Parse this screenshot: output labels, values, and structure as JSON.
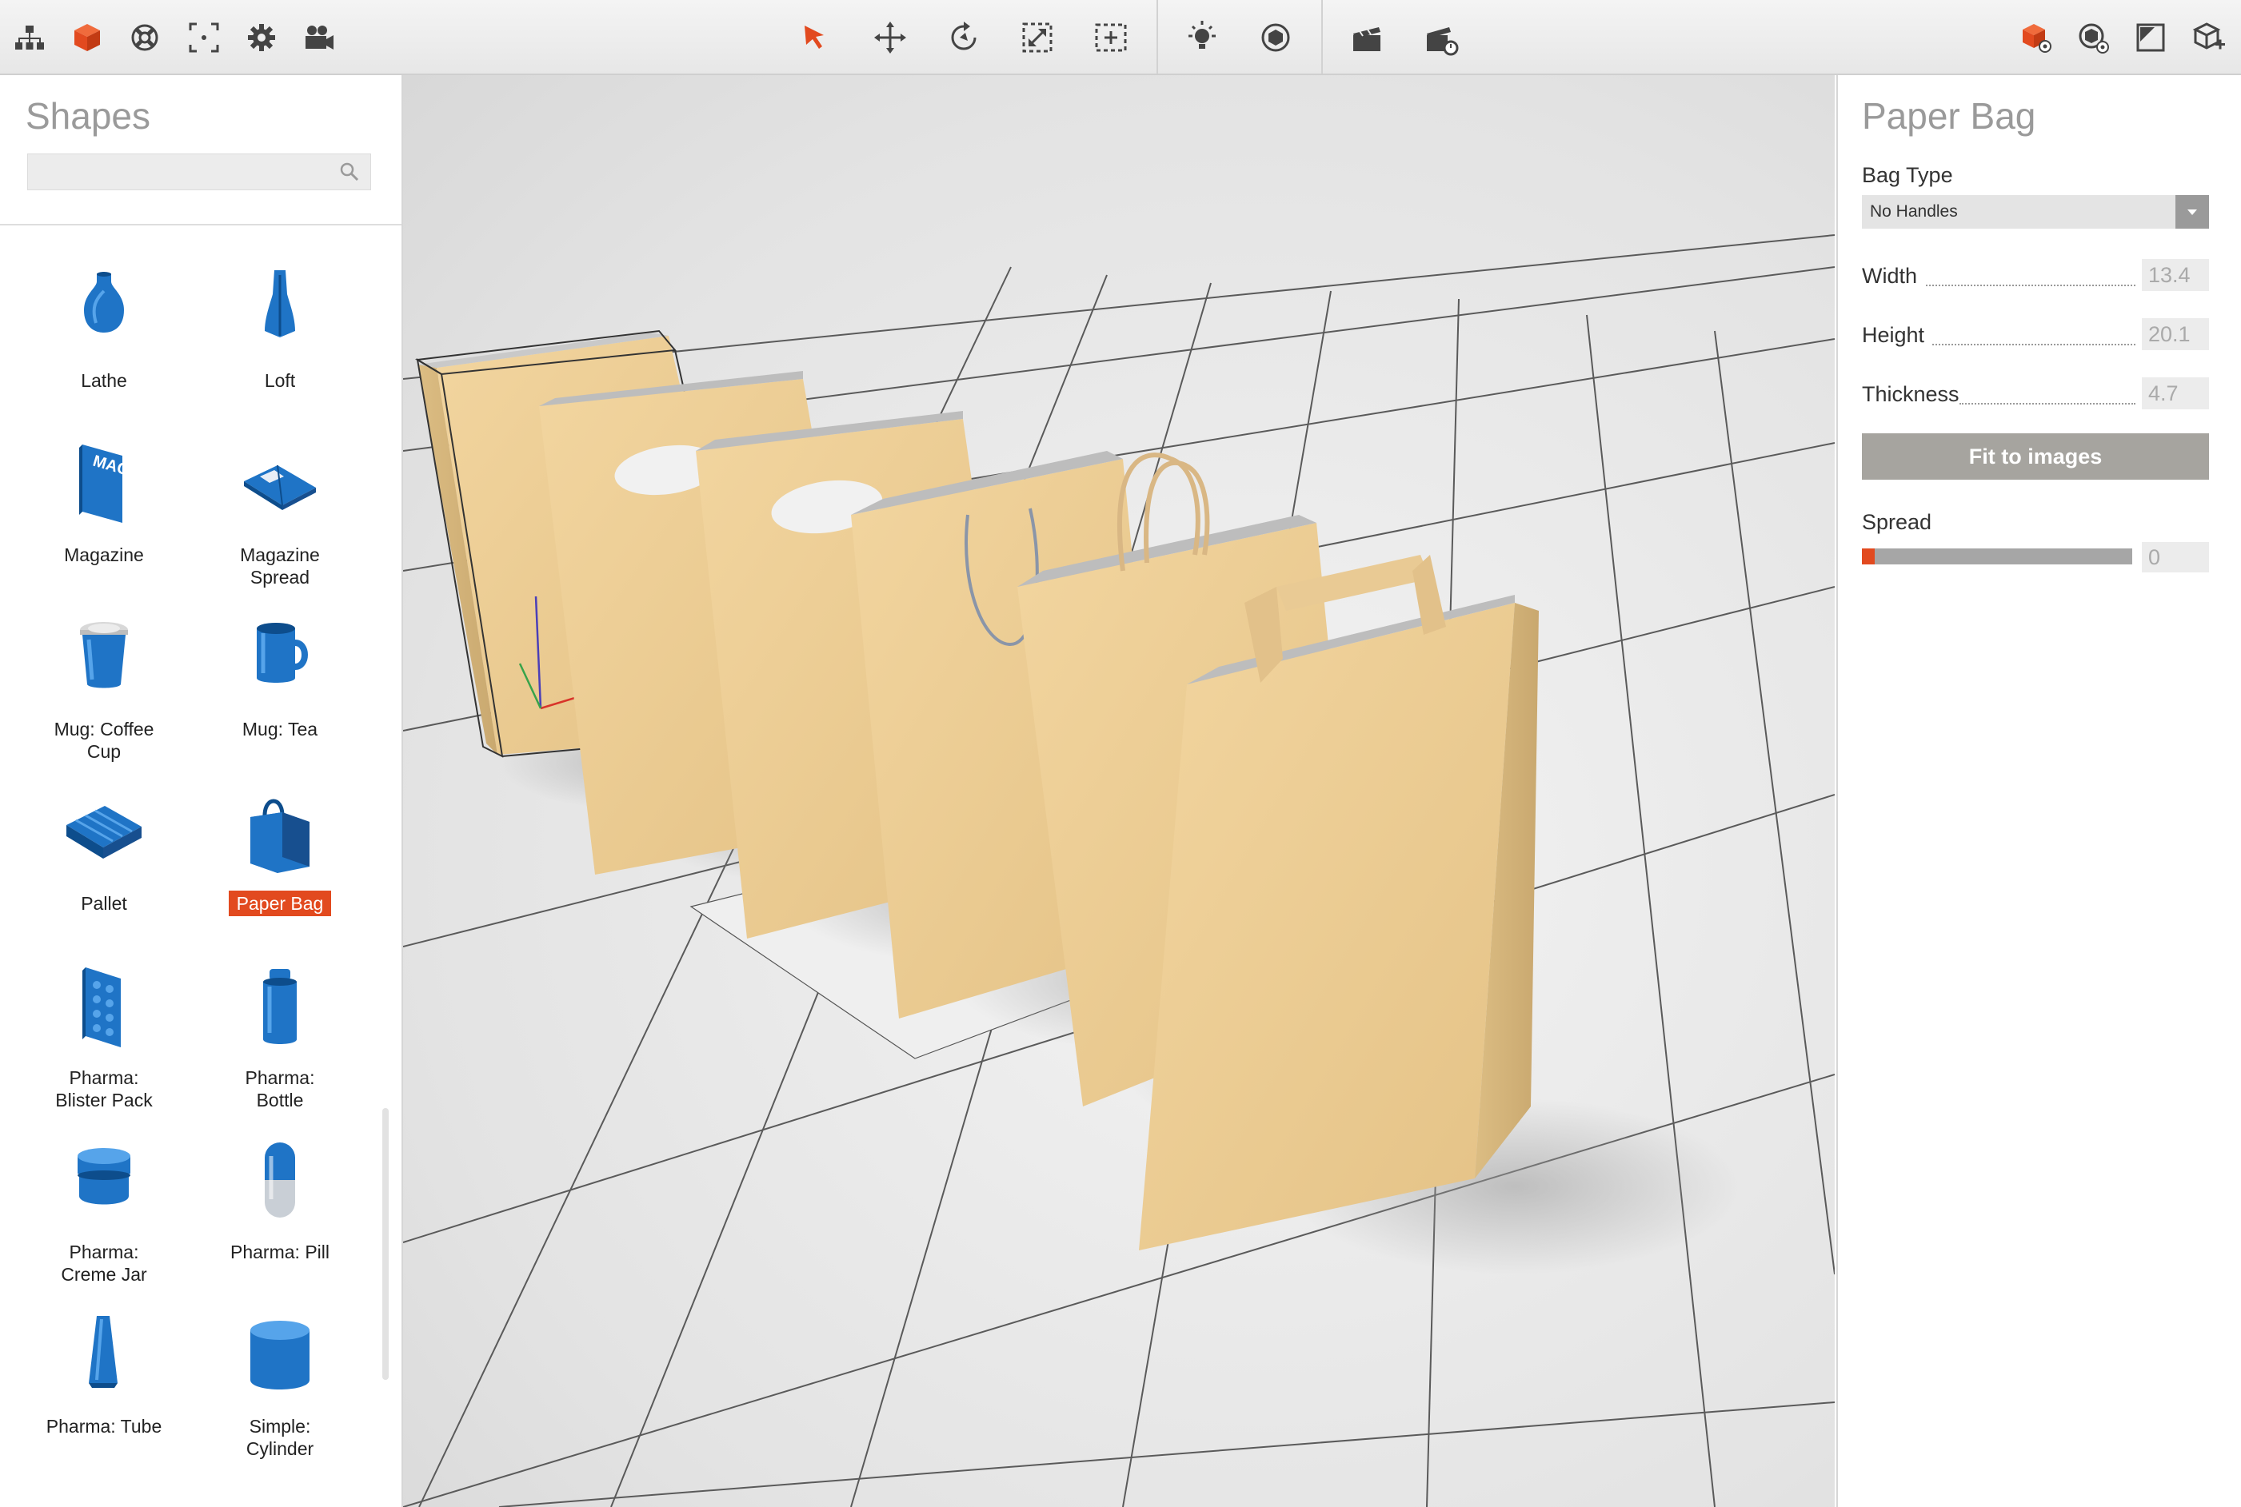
{
  "toolbar": {
    "left_tools": [
      "hierarchy-icon",
      "cube-icon",
      "lifebuoy-icon",
      "focus-frame-icon",
      "gear-icon",
      "camera-icon"
    ],
    "center_tools": [
      "select-arrow-icon",
      "move-icon",
      "rotate-icon",
      "scale-icon",
      "frame-selection-icon",
      "light-icon",
      "environment-icon",
      "clapperboard-icon",
      "render-clapperboard-icon"
    ],
    "right_tools": [
      "object-settings-icon",
      "scene-settings-icon",
      "image-panel-icon",
      "add-shape-icon"
    ],
    "accent_color": "#e24a1f"
  },
  "shapes_panel": {
    "title": "Shapes",
    "search_placeholder": "",
    "items": [
      {
        "label": "Lathe",
        "icon": "vase-icon"
      },
      {
        "label": "Loft",
        "icon": "loft-bottle-icon"
      },
      {
        "label": "Magazine",
        "icon": "magazine-icon"
      },
      {
        "label": "Magazine\nSpread",
        "icon": "magazine-spread-icon"
      },
      {
        "label": "Mug: Coffee\nCup",
        "icon": "coffee-cup-icon"
      },
      {
        "label": "Mug: Tea",
        "icon": "tea-mug-icon"
      },
      {
        "label": "Pallet",
        "icon": "pallet-icon"
      },
      {
        "label": "Paper Bag",
        "icon": "paper-bag-icon",
        "selected": true
      },
      {
        "label": "Pharma:\nBlister Pack",
        "icon": "blister-pack-icon"
      },
      {
        "label": "Pharma:\nBottle",
        "icon": "pharma-bottle-icon"
      },
      {
        "label": "Pharma:\nCreme Jar",
        "icon": "creme-jar-icon"
      },
      {
        "label": "Pharma: Pill",
        "icon": "pill-icon"
      },
      {
        "label": "Pharma: Tube",
        "icon": "tube-icon"
      },
      {
        "label": "Simple:\nCylinder",
        "icon": "cylinder-icon"
      }
    ],
    "icon_color": "#1f74c6"
  },
  "properties": {
    "title": "Paper Bag",
    "bag_type_label": "Bag Type",
    "bag_type_value": "No Handles",
    "width_label": "Width",
    "width_value": "13.4",
    "height_label": "Height",
    "height_value": "20.1",
    "thickness_label": "Thickness",
    "thickness_value": "4.7",
    "fit_button": "Fit to images",
    "spread_label": "Spread",
    "spread_value": "0",
    "spread_level": 0
  },
  "viewport": {
    "objects": [
      "paper-bag-no-handles",
      "paper-bag-die-cut-handle",
      "paper-bag-die-cut-handle-2",
      "paper-bag-rope-handle",
      "paper-bag-twisted-handle",
      "paper-bag-flat-handle"
    ],
    "bag_color": "#edcd92",
    "floor_color": "#e6e6e6"
  }
}
